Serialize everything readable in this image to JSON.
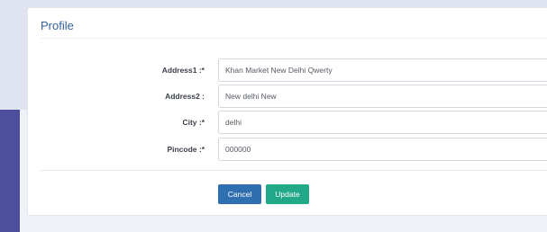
{
  "panel": {
    "title": "Profile"
  },
  "form": {
    "fields": [
      {
        "label": "Address1 :*",
        "value": "Khan Market New Delhi Qwerty"
      },
      {
        "label": "Address2 :",
        "value": "New delhi New"
      },
      {
        "label": "City :*",
        "value": "delhi"
      },
      {
        "label": "Pincode :*",
        "value": "000000"
      }
    ]
  },
  "actions": {
    "cancel_label": "Cancel",
    "update_label": "Update"
  },
  "colors": {
    "accent_blue": "#2f6fb0",
    "accent_green": "#20a889",
    "sidebar_purple": "#4d4e9c",
    "title_color": "#38619a"
  }
}
